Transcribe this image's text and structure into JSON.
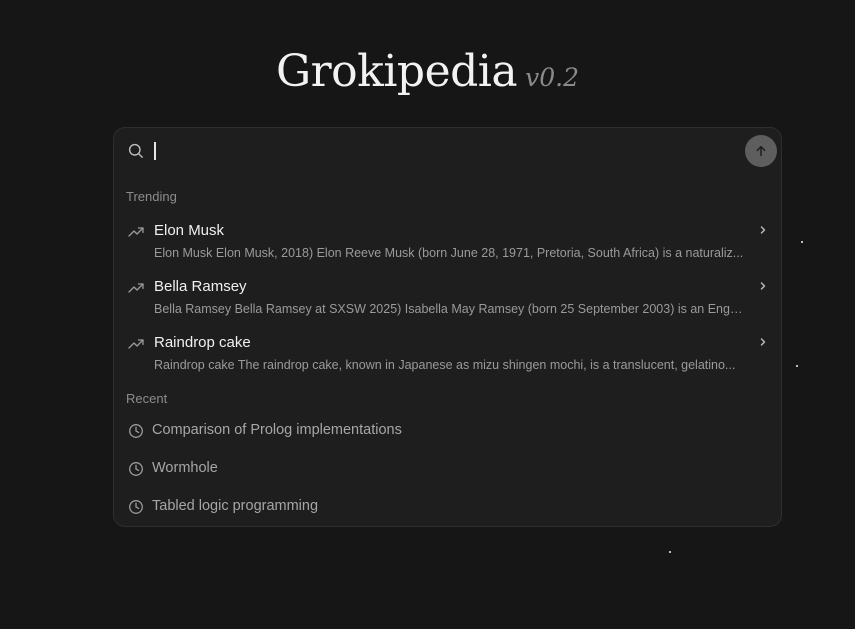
{
  "header": {
    "title": "Grokipedia",
    "version": "v0.2"
  },
  "search": {
    "value": "",
    "placeholder": ""
  },
  "icons": {
    "search": "search-icon",
    "submit": "arrow-up-icon",
    "trending": "trending-up-icon",
    "chevron": "chevron-right-icon",
    "recent": "clock-icon"
  },
  "trending": {
    "label": "Trending",
    "items": [
      {
        "title": "Elon Musk",
        "snippet": "Elon Musk Elon Musk, 2018) Elon Reeve Musk (born June 28, 1971, Pretoria, South Africa) is a naturaliz..."
      },
      {
        "title": "Bella Ramsey",
        "snippet": "Bella Ramsey Bella Ramsey at SXSW 2025) Isabella May Ramsey (born 25 September 2003) is an Engli..."
      },
      {
        "title": "Raindrop cake",
        "snippet": "Raindrop cake The raindrop cake, known in Japanese as mizu shingen mochi, is a translucent, gelatino..."
      }
    ]
  },
  "recent": {
    "label": "Recent",
    "items": [
      {
        "title": "Comparison of Prolog implementations"
      },
      {
        "title": "Wormhole"
      },
      {
        "title": "Tabled logic programming"
      }
    ]
  },
  "colors": {
    "background": "#161616",
    "panel": "#1e1e1e",
    "submit_button": "#5e5e5e"
  }
}
